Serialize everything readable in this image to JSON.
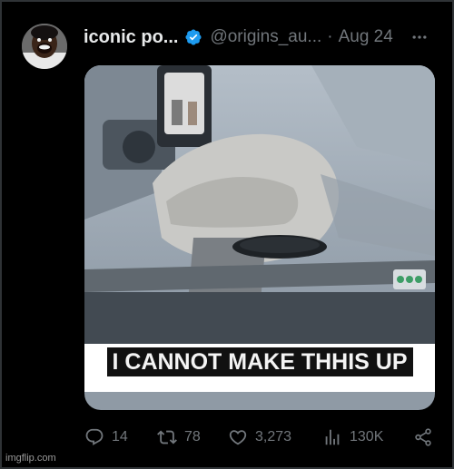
{
  "tweet": {
    "display_name": "iconic po...",
    "handle": "@origins_au...",
    "separator": "·",
    "date": "Aug 24",
    "caption": "I CANNOT MAKE THHIS UP"
  },
  "actions": {
    "replies": "14",
    "reposts": "78",
    "likes": "3,273",
    "views": "130K"
  },
  "watermark": "imgflip.com",
  "colors": {
    "background": "#000000",
    "text_primary": "#e7e9ea",
    "text_secondary": "#71767b",
    "verified": "#1d9bf0"
  },
  "icons": [
    "avatar",
    "verified-badge-icon",
    "more-icon",
    "reply-icon",
    "repost-icon",
    "like-icon",
    "views-icon",
    "share-icon"
  ]
}
